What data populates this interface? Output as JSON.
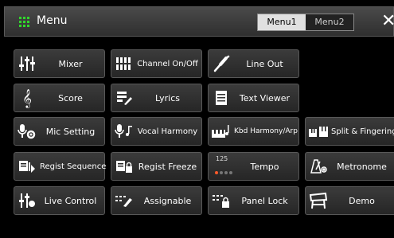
{
  "window": {
    "title": "Menu",
    "close_glyph": "✕"
  },
  "tabs": [
    {
      "label": "Menu1",
      "active": true
    },
    {
      "label": "Menu2",
      "active": false
    }
  ],
  "buttons": {
    "mixer": {
      "label": "Mixer",
      "icon": "mixer-sliders-icon"
    },
    "channel_onoff": {
      "label": "Channel On/Off",
      "icon": "channel-bars-icon"
    },
    "line_out": {
      "label": "Line Out",
      "icon": "cable-plug-icon"
    },
    "score": {
      "label": "Score",
      "icon": "treble-clef-icon"
    },
    "lyrics": {
      "label": "Lyrics",
      "icon": "lyrics-pen-icon"
    },
    "text_viewer": {
      "label": "Text Viewer",
      "icon": "document-icon"
    },
    "mic_setting": {
      "label": "Mic Setting",
      "icon": "mic-gear-icon"
    },
    "vocal_harmony": {
      "label": "Vocal Harmony",
      "icon": "mic-notes-icon"
    },
    "kbd_harmony": {
      "label": "Kbd Harmony/Arp",
      "icon": "keyboard-notes-icon"
    },
    "split_fingering": {
      "label": "Split & Fingering",
      "icon": "split-keyboard-icon"
    },
    "regist_sequence": {
      "label": "Regist Sequence",
      "icon": "regist-sequence-icon"
    },
    "regist_freeze": {
      "label": "Regist Freeze",
      "icon": "regist-freeze-icon"
    },
    "tempo": {
      "label": "Tempo",
      "value": "125",
      "icon": "tempo-dots-icon",
      "beat": 1,
      "beats": 4
    },
    "metronome": {
      "label": "Metronome",
      "icon": "metronome-icon"
    },
    "live_control": {
      "label": "Live Control",
      "icon": "live-control-knobs-icon"
    },
    "assignable": {
      "label": "Assignable",
      "icon": "assignable-pen-icon"
    },
    "panel_lock": {
      "label": "Panel Lock",
      "icon": "panel-lock-icon"
    },
    "demo": {
      "label": "Demo",
      "icon": "demo-piano-icon"
    }
  },
  "colors": {
    "accent_green": "#31d62c",
    "tempo_beat": "#ff5a2a",
    "button_bg": "#303030"
  }
}
